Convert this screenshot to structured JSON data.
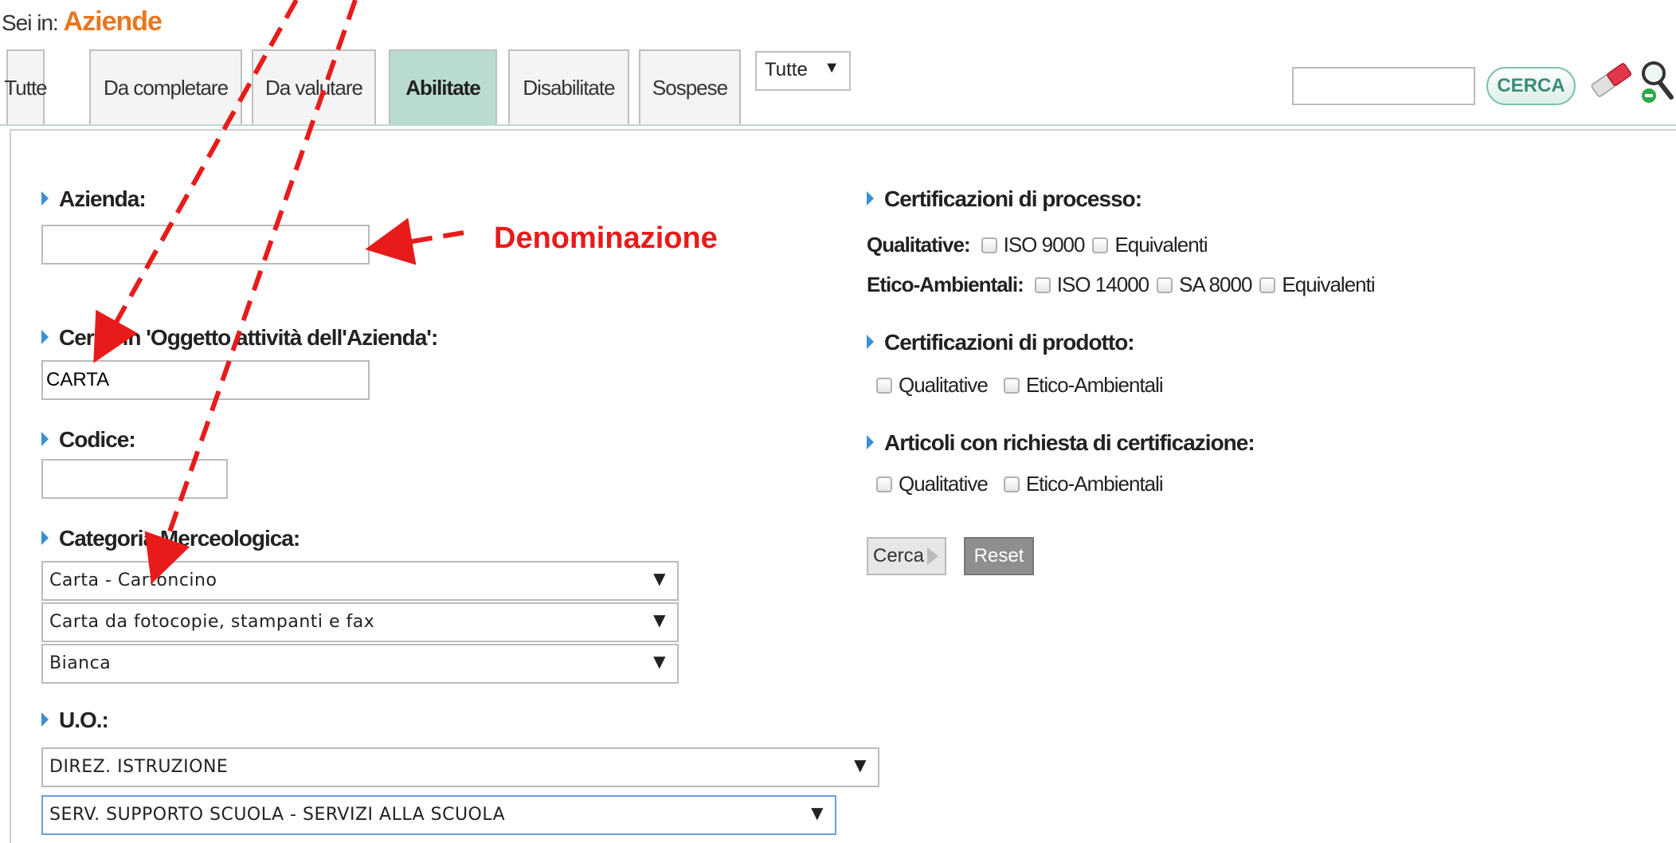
{
  "breadcrumb": {
    "prefix": "Sei in:",
    "current": "Aziende"
  },
  "tabs": [
    {
      "label": "Tutte",
      "active": false
    },
    {
      "label": "Da completare",
      "active": false
    },
    {
      "label": "Da valutare",
      "active": false
    },
    {
      "label": "Abilitate",
      "active": true
    },
    {
      "label": "Disabilitate",
      "active": false
    },
    {
      "label": "Sospese",
      "active": false
    }
  ],
  "filter_select": {
    "value": "Tutte"
  },
  "search": {
    "value": "",
    "button_label": "CERCA"
  },
  "form": {
    "azienda": {
      "label": "Azienda:",
      "value": ""
    },
    "oggetto": {
      "label": "Cerca in 'Oggetto attività dell'Azienda':",
      "value": "CARTA"
    },
    "codice": {
      "label": "Codice:",
      "value": ""
    },
    "categoria": {
      "label": "Categoria Merceologica:",
      "selects": [
        "Carta - Cartoncino",
        "Carta da fotocopie, stampanti e fax",
        "Bianca"
      ]
    },
    "uo": {
      "label": "U.O.:",
      "selects": [
        "DIREZ. ISTRUZIONE",
        "SERV. SUPPORTO SCUOLA - SERVIZI ALLA SCUOLA"
      ]
    },
    "cert_processo": {
      "label": "Certificazioni di processo:",
      "qualitative": {
        "label": "Qualitative:",
        "options": [
          "ISO 9000",
          "Equivalenti"
        ]
      },
      "etico": {
        "label": "Etico-Ambientali:",
        "options": [
          "ISO 14000",
          "SA 8000",
          "Equivalenti"
        ]
      }
    },
    "cert_prodotto": {
      "label": "Certificazioni di prodotto:",
      "options": [
        "Qualitative",
        "Etico-Ambientali"
      ]
    },
    "articoli": {
      "label": "Articoli con richiesta di certificazione:",
      "options": [
        "Qualitative",
        "Etico-Ambientali"
      ]
    },
    "buttons": {
      "cerca": "Cerca",
      "reset": "Reset"
    }
  },
  "annotation": {
    "text": "Denominazione",
    "color": "#e81b1b"
  },
  "colors": {
    "accent": "#e8771e",
    "active_tab": "#b9dbd2",
    "bullet": "#3b8fd6"
  },
  "icons": [
    "eraser-icon",
    "magnifier-icon",
    "dropdown-arrow-icon"
  ]
}
